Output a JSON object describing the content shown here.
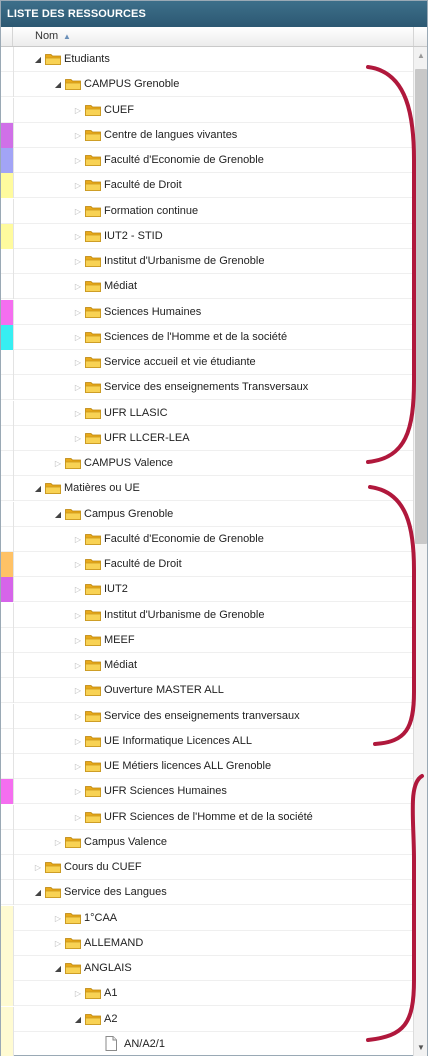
{
  "panel": {
    "title": "LISTE DES RESSOURCES",
    "column_header": "Nom",
    "sort_direction": "ascending"
  },
  "colors": {
    "title_bar": "#2f5d78",
    "annotation": "#b0183c",
    "folder": "#f2c12e"
  },
  "tree": [
    {
      "label": "Etudiants",
      "depth": 0,
      "state": "open",
      "icon": "folder-icon",
      "swatch": ""
    },
    {
      "label": "CAMPUS Grenoble",
      "depth": 1,
      "state": "open",
      "icon": "folder-icon",
      "swatch": ""
    },
    {
      "label": "CUEF",
      "depth": 2,
      "state": "closed",
      "icon": "folder-icon",
      "swatch": ""
    },
    {
      "label": "Centre de langues vivantes",
      "depth": 2,
      "state": "closed",
      "icon": "folder-icon",
      "swatch": "#d070e8"
    },
    {
      "label": "Faculté d'Economie de Grenoble",
      "depth": 2,
      "state": "closed",
      "icon": "folder-icon",
      "swatch": "#a2a4f6"
    },
    {
      "label": "Faculté de Droit",
      "depth": 2,
      "state": "closed",
      "icon": "folder-icon",
      "swatch": "#fffb9e"
    },
    {
      "label": "Formation continue",
      "depth": 2,
      "state": "closed",
      "icon": "folder-icon",
      "swatch": ""
    },
    {
      "label": "IUT2 - STID",
      "depth": 2,
      "state": "closed",
      "icon": "folder-icon",
      "swatch": "#fffb9e"
    },
    {
      "label": "Institut d'Urbanisme de Grenoble",
      "depth": 2,
      "state": "closed",
      "icon": "folder-icon",
      "swatch": ""
    },
    {
      "label": "Médiat",
      "depth": 2,
      "state": "closed",
      "icon": "folder-icon",
      "swatch": ""
    },
    {
      "label": "Sciences Humaines",
      "depth": 2,
      "state": "closed",
      "icon": "folder-icon",
      "swatch": "#f56ef0"
    },
    {
      "label": "Sciences de l'Homme et de la société",
      "depth": 2,
      "state": "closed",
      "icon": "folder-icon",
      "swatch": "#37eef2"
    },
    {
      "label": "Service accueil et vie étudiante",
      "depth": 2,
      "state": "closed",
      "icon": "folder-icon",
      "swatch": ""
    },
    {
      "label": "Service des enseignements Transversaux",
      "depth": 2,
      "state": "closed",
      "icon": "folder-icon",
      "swatch": ""
    },
    {
      "label": "UFR LLASIC",
      "depth": 2,
      "state": "closed",
      "icon": "folder-icon",
      "swatch": ""
    },
    {
      "label": "UFR LLCER-LEA",
      "depth": 2,
      "state": "closed",
      "icon": "folder-icon",
      "swatch": ""
    },
    {
      "label": "CAMPUS Valence",
      "depth": 1,
      "state": "closed",
      "icon": "folder-icon",
      "swatch": ""
    },
    {
      "label": "Matières ou UE",
      "depth": 0,
      "state": "open",
      "icon": "folder-icon",
      "swatch": ""
    },
    {
      "label": "Campus Grenoble",
      "depth": 1,
      "state": "open",
      "icon": "folder-icon",
      "swatch": ""
    },
    {
      "label": "Faculté d'Economie de Grenoble",
      "depth": 2,
      "state": "closed",
      "icon": "folder-icon",
      "swatch": ""
    },
    {
      "label": "Faculté de Droit",
      "depth": 2,
      "state": "closed",
      "icon": "folder-icon",
      "swatch": "#ffc266"
    },
    {
      "label": "IUT2",
      "depth": 2,
      "state": "closed",
      "icon": "folder-icon",
      "swatch": "#d664ea"
    },
    {
      "label": "Institut d'Urbanisme de Grenoble",
      "depth": 2,
      "state": "closed",
      "icon": "folder-icon",
      "swatch": ""
    },
    {
      "label": "MEEF",
      "depth": 2,
      "state": "closed",
      "icon": "folder-icon",
      "swatch": ""
    },
    {
      "label": "Médiat",
      "depth": 2,
      "state": "closed",
      "icon": "folder-icon",
      "swatch": ""
    },
    {
      "label": "Ouverture MASTER ALL",
      "depth": 2,
      "state": "closed",
      "icon": "folder-icon",
      "swatch": ""
    },
    {
      "label": "Service des enseignements tranversaux",
      "depth": 2,
      "state": "closed",
      "icon": "folder-icon",
      "swatch": ""
    },
    {
      "label": "UE Informatique Licences ALL",
      "depth": 2,
      "state": "closed",
      "icon": "folder-icon",
      "swatch": ""
    },
    {
      "label": "UE Métiers licences ALL Grenoble",
      "depth": 2,
      "state": "closed",
      "icon": "folder-icon",
      "swatch": ""
    },
    {
      "label": "UFR Sciences Humaines",
      "depth": 2,
      "state": "closed",
      "icon": "folder-icon",
      "swatch": "#f56ef0"
    },
    {
      "label": "UFR Sciences de l'Homme et de la société",
      "depth": 2,
      "state": "closed",
      "icon": "folder-icon",
      "swatch": ""
    },
    {
      "label": "Campus Valence",
      "depth": 1,
      "state": "closed",
      "icon": "folder-icon",
      "swatch": ""
    },
    {
      "label": "Cours du CUEF",
      "depth": 0,
      "state": "closed",
      "icon": "folder-icon",
      "swatch": ""
    },
    {
      "label": "Service des Langues",
      "depth": 0,
      "state": "open",
      "icon": "folder-icon",
      "swatch": ""
    },
    {
      "label": "1°CAA",
      "depth": 1,
      "state": "closed",
      "icon": "folder-icon",
      "swatch": "#fffbd2"
    },
    {
      "label": "ALLEMAND",
      "depth": 1,
      "state": "closed",
      "icon": "folder-icon",
      "swatch": "#fffbd2"
    },
    {
      "label": "ANGLAIS",
      "depth": 1,
      "state": "open",
      "icon": "folder-icon",
      "swatch": "#fffbd2"
    },
    {
      "label": "A1",
      "depth": 2,
      "state": "closed",
      "icon": "folder-icon",
      "swatch": "#fffbd2"
    },
    {
      "label": "A2",
      "depth": 2,
      "state": "open",
      "icon": "folder-icon",
      "swatch": "#fffbd2"
    },
    {
      "label": "AN/A2/1",
      "depth": 3,
      "state": "leaf",
      "icon": "file-icon",
      "swatch": "#fffbd2"
    }
  ]
}
